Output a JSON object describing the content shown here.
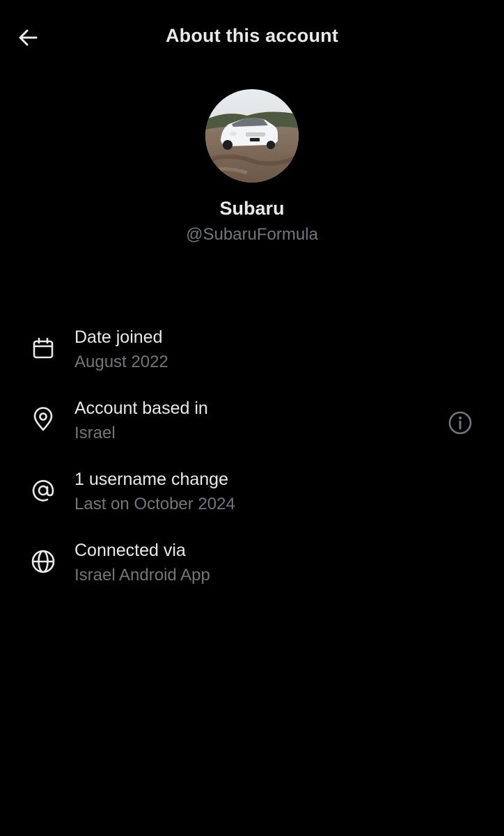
{
  "header": {
    "title": "About this account",
    "back_icon": "arrow-left-icon"
  },
  "profile": {
    "display_name": "Subaru",
    "handle": "@SubaruFormula",
    "avatar_description_icon": "avatar-photo"
  },
  "info_items": [
    {
      "icon": "calendar-icon",
      "title": "Date joined",
      "value": "August 2022"
    },
    {
      "icon": "location-pin-icon",
      "title": "Account based in",
      "value": "Israel",
      "trailing_icon": "info-icon"
    },
    {
      "icon": "at-sign-icon",
      "title": "1 username change",
      "value": "Last on October 2024"
    },
    {
      "icon": "globe-icon",
      "title": "Connected via",
      "value": "Israel Android App"
    }
  ],
  "colors": {
    "background": "#000000",
    "primary_text": "#e7e9ea",
    "secondary_text": "#71767b"
  }
}
